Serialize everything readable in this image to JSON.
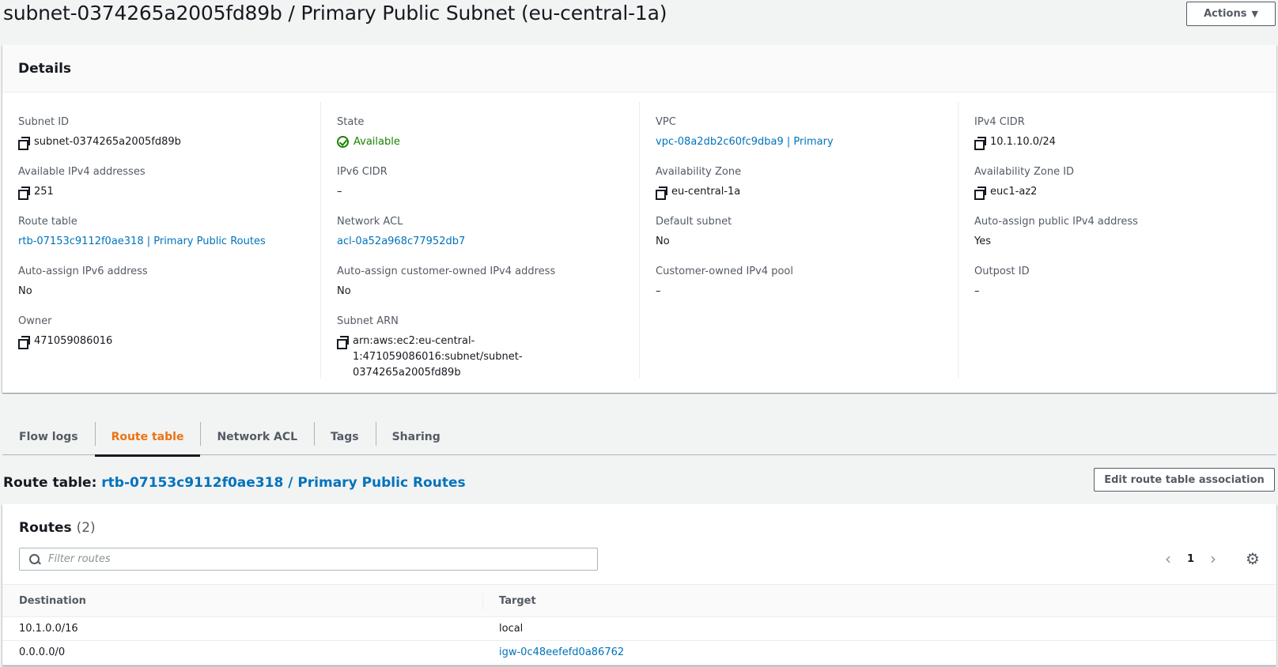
{
  "header": {
    "title": "subnet-0374265a2005fd89b / Primary Public Subnet (eu-central-1a)",
    "actions_label": "Actions"
  },
  "details": {
    "title": "Details",
    "col1": [
      {
        "key": "Subnet ID",
        "value": "subnet-0374265a2005fd89b"
      },
      {
        "key": "Available IPv4 addresses",
        "value": "251"
      },
      {
        "key": "Route table",
        "value": "rtb-07153c9112f0ae318 | Primary Public Routes"
      },
      {
        "key": "Auto-assign IPv6 address",
        "value": "No"
      },
      {
        "key": "Owner",
        "value": "471059086016"
      }
    ],
    "col2": [
      {
        "key": "State",
        "value": "Available"
      },
      {
        "key": "IPv6 CIDR",
        "value": "–"
      },
      {
        "key": "Network ACL",
        "value": "acl-0a52a968c77952db7"
      },
      {
        "key": "Auto-assign customer-owned IPv4 address",
        "value": "No"
      },
      {
        "key": "Subnet ARN",
        "value": "arn:aws:ec2:eu-central-\n1:471059086016:subnet/subnet-0374265a2005fd89b"
      }
    ],
    "col3": [
      {
        "key": "VPC",
        "value": "vpc-08a2db2c60fc9dba9 | Primary"
      },
      {
        "key": "Availability Zone",
        "value": "eu-central-1a"
      },
      {
        "key": "Default subnet",
        "value": "No"
      },
      {
        "key": "Customer-owned IPv4 pool",
        "value": "–"
      }
    ],
    "col4": [
      {
        "key": "IPv4 CIDR",
        "value": "10.1.10.0/24"
      },
      {
        "key": "Availability Zone ID",
        "value": "euc1-az2"
      },
      {
        "key": "Auto-assign public IPv4 address",
        "value": "Yes"
      },
      {
        "key": "Outpost ID",
        "value": "–"
      }
    ]
  },
  "tabs": [
    {
      "label": "Flow logs"
    },
    {
      "label": "Route table"
    },
    {
      "label": "Network ACL"
    },
    {
      "label": "Tags"
    },
    {
      "label": "Sharing"
    }
  ],
  "route_table": {
    "prefix": "Route table:",
    "link": "rtb-07153c9112f0ae318 / Primary Public Routes",
    "edit_label": "Edit route table association"
  },
  "routes": {
    "title": "Routes",
    "count": "(2)",
    "filter_placeholder": "Filter routes",
    "page": "1",
    "columns": [
      "Destination",
      "Target"
    ],
    "rows": [
      {
        "destination": "10.1.0.0/16",
        "target": "local"
      },
      {
        "destination": "0.0.0.0/0",
        "target": "igw-0c48eefefd0a86762"
      }
    ]
  }
}
